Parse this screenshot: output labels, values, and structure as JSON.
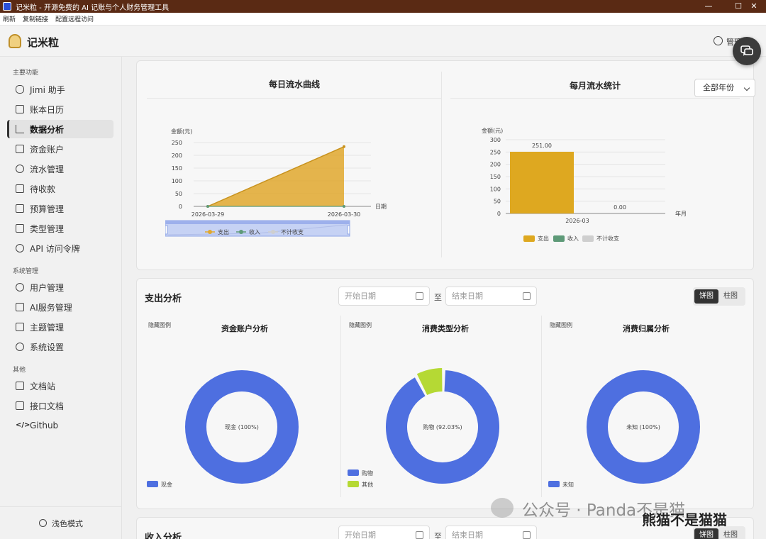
{
  "window": {
    "title": "记米粒 - 开源免费的 AI 记账与个人财务管理工具",
    "minimize": "—",
    "maximize": "☐",
    "close": "✕"
  },
  "menubar": {
    "items": [
      "刷新",
      "复制链接",
      "配置远程访问"
    ]
  },
  "app": {
    "name": "记米粒",
    "user": "管理员"
  },
  "sidebar": {
    "groups": [
      {
        "label": "主要功能",
        "items": [
          "Jimi 助手",
          "账本日历",
          "数据分析",
          "资金账户",
          "流水管理",
          "待收款",
          "预算管理",
          "类型管理",
          "API 访问令牌"
        ]
      },
      {
        "label": "系统管理",
        "items": [
          "用户管理",
          "AI服务管理",
          "主题管理",
          "系统设置"
        ]
      },
      {
        "label": "其他",
        "items": [
          "文档站",
          "接口文档",
          "Github"
        ]
      }
    ],
    "active_item": "数据分析",
    "footer_label": "浅色模式"
  },
  "daily_chart": {
    "title": "每日流水曲线",
    "chart_data": {
      "type": "area",
      "title": "每日流水曲线",
      "ylabel": "金额(元)",
      "xlabel": "日期",
      "x": [
        "2026-03-29",
        "2026-03-30"
      ],
      "ylim": [
        0,
        250
      ],
      "yticks": [
        "0",
        "50",
        "100",
        "150",
        "200",
        "250"
      ],
      "series": [
        {
          "name": "支出",
          "values": [
            0,
            234
          ],
          "color": "#e0a82e"
        },
        {
          "name": "收入",
          "values": [
            0,
            0
          ],
          "color": "#5e9a78"
        }
      ],
      "legend": [
        "支出",
        "收入",
        "不计收支"
      ],
      "legend_placement": "bottom",
      "grid": true
    }
  },
  "monthly_chart": {
    "title": "每月流水统计",
    "year_select": "全部年份",
    "chart_data": {
      "type": "bar",
      "title": "每月流水统计",
      "ylabel": "金额(元)",
      "xlabel": "年月",
      "categories": [
        "2026-03"
      ],
      "ylim": [
        0,
        300
      ],
      "yticks": [
        "0",
        "50",
        "100",
        "150",
        "200",
        "250",
        "300"
      ],
      "series": [
        {
          "name": "支出",
          "values": [
            251.0
          ],
          "labels": [
            "251.00"
          ],
          "color": "#dea820"
        },
        {
          "name": "收入",
          "values": [
            0.0
          ],
          "labels": [
            "0.00"
          ],
          "color": "#5e9a78"
        }
      ],
      "legend": [
        "支出",
        "收入",
        "不计收支"
      ],
      "legend_placement": "bottom",
      "grid": true
    }
  },
  "expense_section": {
    "title": "支出分析",
    "start_placeholder": "开始日期",
    "to": "至",
    "end_placeholder": "结束日期",
    "toggle": [
      "饼图",
      "柱图"
    ],
    "hide_legend": "隐藏图例",
    "pies": [
      {
        "title": "资金账户分析",
        "chart_data": {
          "type": "pie",
          "title": "资金账户分析",
          "slices": [
            {
              "label": "现金",
              "value": 100.0,
              "display": "现金 (100%)",
              "color": "#4e6fe0"
            }
          ]
        }
      },
      {
        "title": "消费类型分析",
        "chart_data": {
          "type": "pie",
          "title": "消费类型分析",
          "slices": [
            {
              "label": "购物",
              "value": 92.03,
              "display": "购物 (92.03%)",
              "color": "#4e6fe0"
            },
            {
              "label": "其他",
              "value": 7.97,
              "display": "其他",
              "color": "#b5d934"
            }
          ]
        }
      },
      {
        "title": "消费归属分析",
        "chart_data": {
          "type": "pie",
          "title": "消费归属分析",
          "slices": [
            {
              "label": "未知",
              "value": 100.0,
              "display": "未知 (100%)",
              "color": "#4e6fe0"
            }
          ]
        }
      }
    ]
  },
  "income_section": {
    "title": "收入分析",
    "start_placeholder": "开始日期",
    "to": "至",
    "end_placeholder": "结束日期",
    "toggle": [
      "饼图",
      "柱图"
    ]
  },
  "watermark": {
    "text": "公众号 · Panda不是猫",
    "overlay": "熊猫不是猫猫"
  }
}
